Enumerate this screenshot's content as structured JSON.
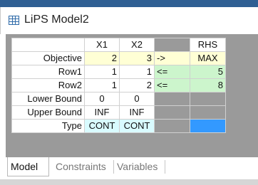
{
  "window": {
    "title": "LiPS Model2",
    "icon": "spreadsheet-grid-icon"
  },
  "grid": {
    "column_headers": [
      "X1",
      "X2",
      "RHS"
    ],
    "rows": {
      "objective": {
        "label": "Objective",
        "x1": "2",
        "x2": "3",
        "rel": "->",
        "rhs": "MAX"
      },
      "row1": {
        "label": "Row1",
        "x1": "1",
        "x2": "1",
        "rel": "<=",
        "rhs": "5"
      },
      "row2": {
        "label": "Row2",
        "x1": "1",
        "x2": "2",
        "rel": "<=",
        "rhs": "8"
      },
      "lower_bound": {
        "label": "Lower Bound",
        "x1": "0",
        "x2": "0"
      },
      "upper_bound": {
        "label": "Upper Bound",
        "x1": "INF",
        "x2": "INF"
      },
      "type": {
        "label": "Type",
        "x1": "CONT",
        "x2": "CONT"
      }
    }
  },
  "tabs": [
    "Model",
    "Constraints",
    "Variables"
  ],
  "colors": {
    "title_strip": "#2f5f93",
    "client_background": "#9a9a9a",
    "objective_fill": "#ffffd5",
    "constraint_fill": "#ccf5cc",
    "type_fill": "#d9fbff",
    "selected_cell": "#3399ff"
  }
}
